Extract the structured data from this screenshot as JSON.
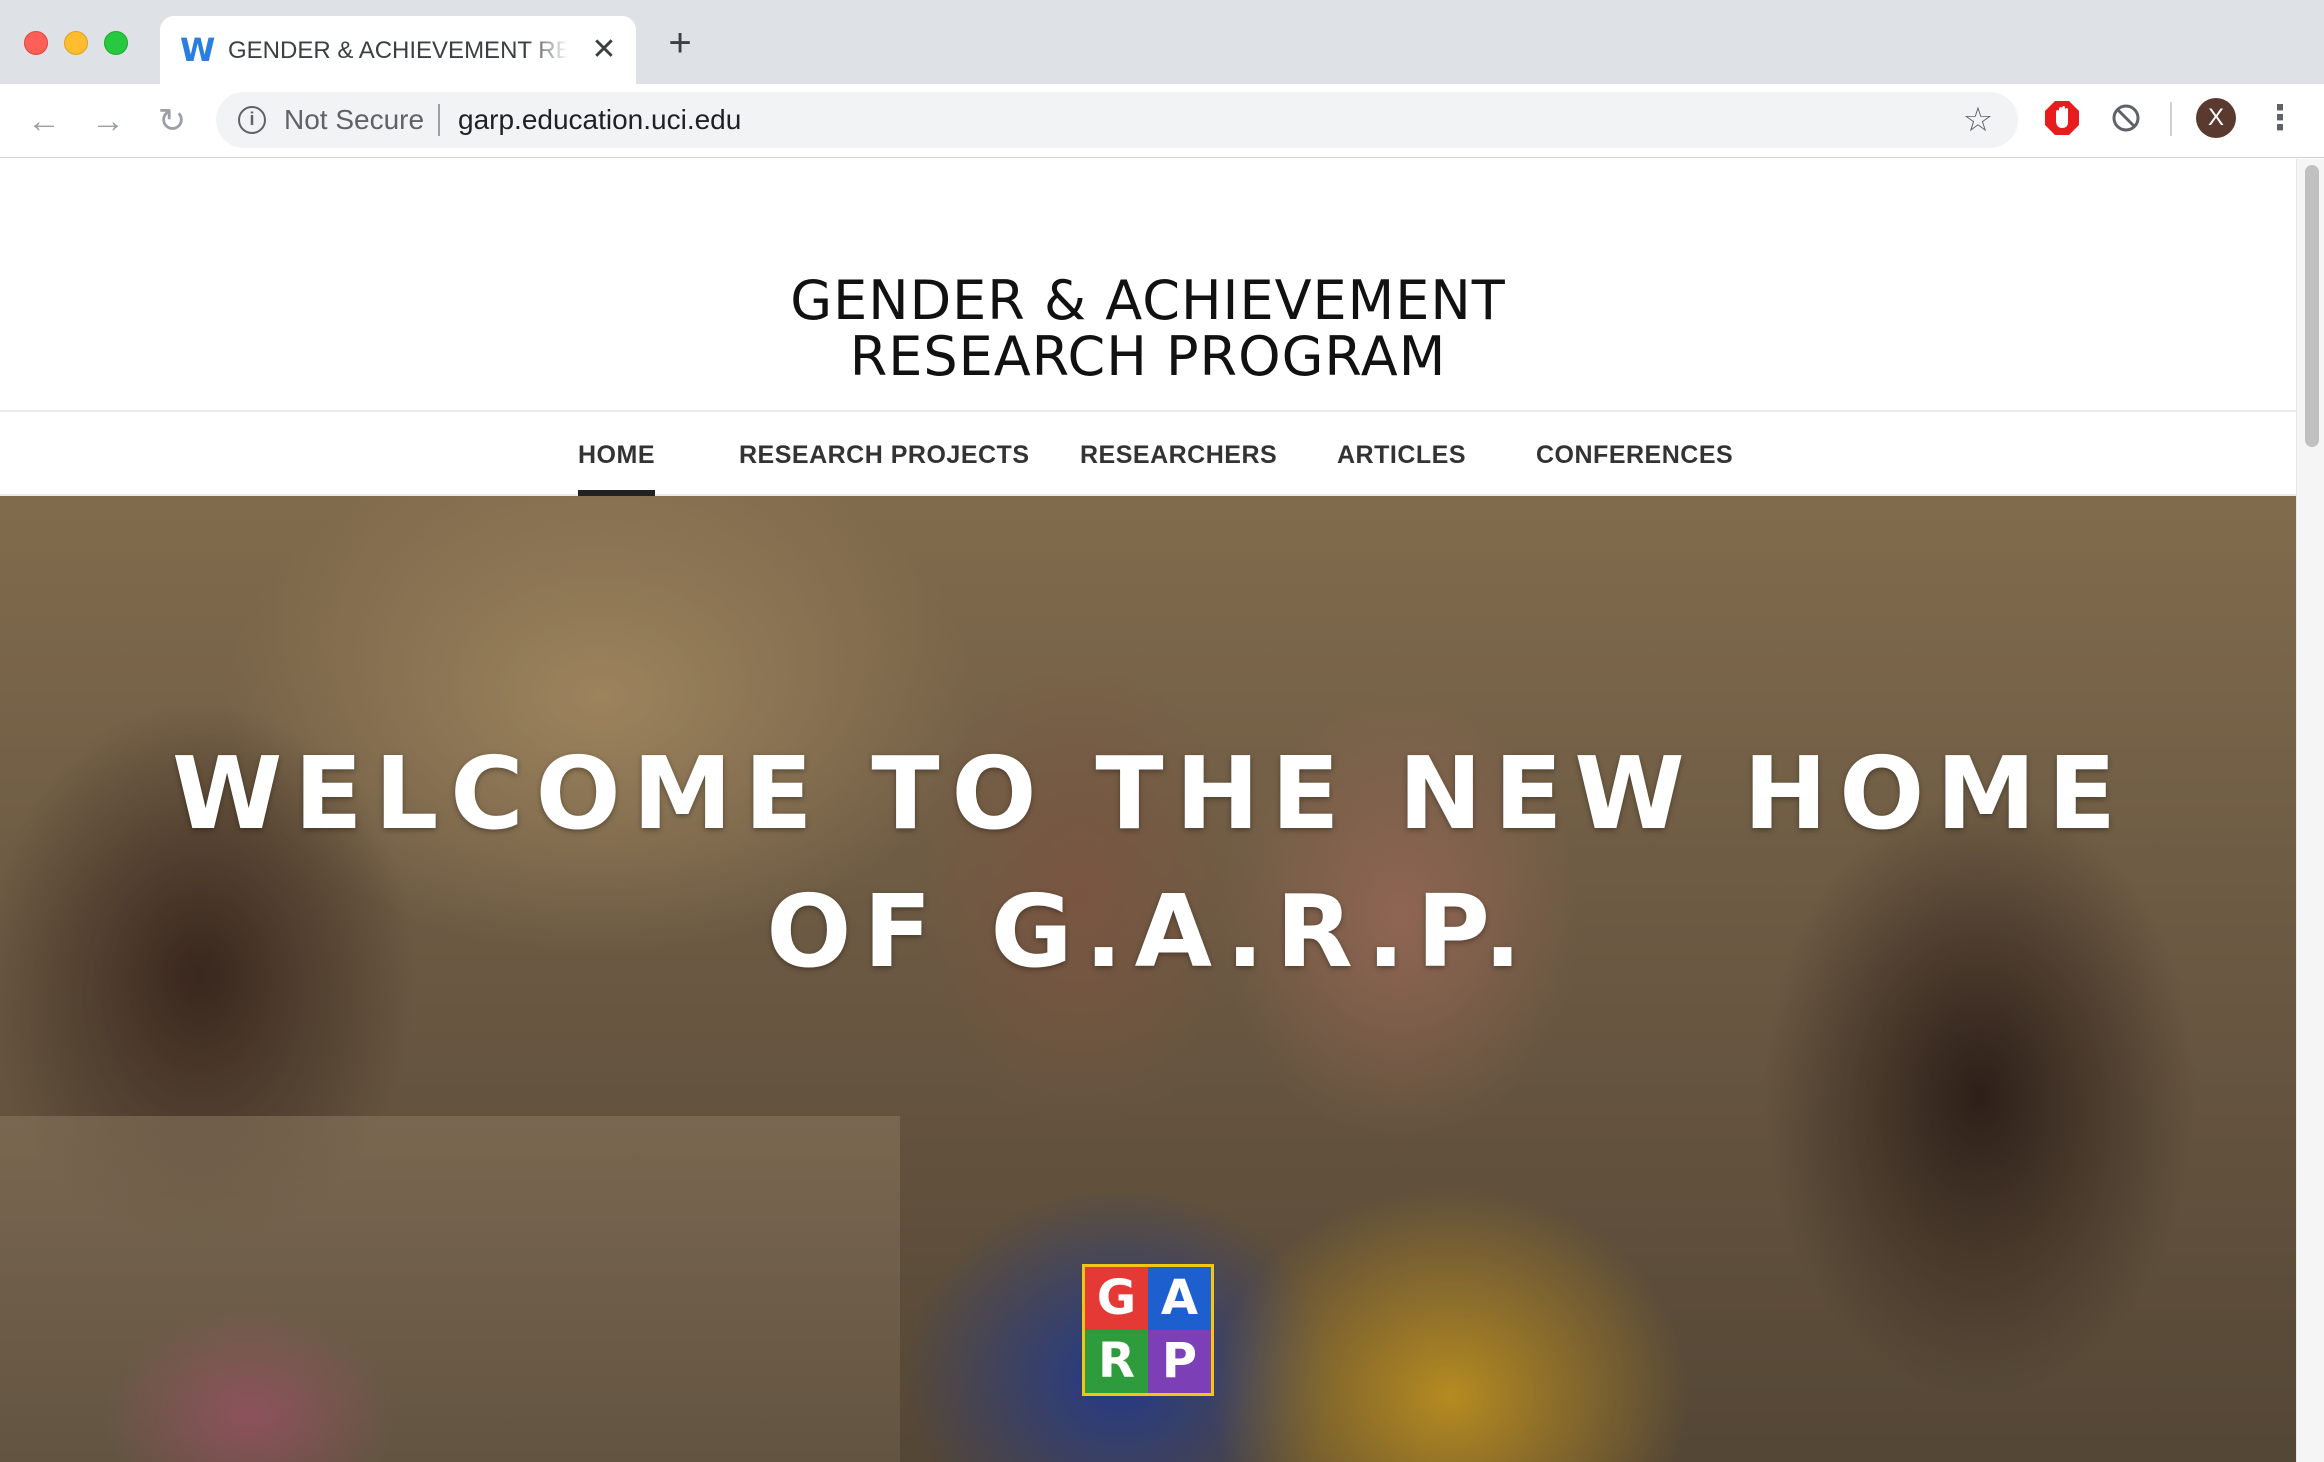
{
  "browser": {
    "tab": {
      "title": "GENDER & ACHIEVEMENT RESEARCH PROGRAM",
      "favicon_icon": "weebly-w-icon",
      "favicon_glyph": "W",
      "close_glyph": "✕"
    },
    "new_tab_glyph": "+",
    "nav": {
      "back_glyph": "←",
      "forward_glyph": "→",
      "reload_glyph": "↻"
    },
    "omnibox": {
      "info_glyph": "i",
      "security_label": "Not Secure",
      "url": "garp.education.uci.edu",
      "bookmark_glyph": "☆"
    },
    "profile_initial": "X",
    "menu_glyph": "⋮",
    "colors": {
      "adblock_red": "#e81c1c",
      "tab_bar": "#dee1e6"
    }
  },
  "site": {
    "title_line1": "GENDER & ACHIEVEMENT",
    "title_line2": "RESEARCH PROGRAM",
    "nav": [
      {
        "label": "HOME",
        "active": true
      },
      {
        "label": "RESEARCH PROJECTS",
        "active": false
      },
      {
        "label": "RESEARCHERS",
        "active": false
      },
      {
        "label": "ARTICLES",
        "active": false
      },
      {
        "label": "CONFERENCES",
        "active": false
      }
    ],
    "hero": {
      "heading_line1": "WELCOME TO THE NEW HOME",
      "heading_line2": "OF G.A.R.P.",
      "logo_letters": [
        "G",
        "A",
        "R",
        "P"
      ],
      "logo_colors": [
        "#e53935",
        "#1e5fd0",
        "#2e9b3c",
        "#7d3fb5"
      ],
      "logo_border_color": "#f3c614"
    }
  }
}
